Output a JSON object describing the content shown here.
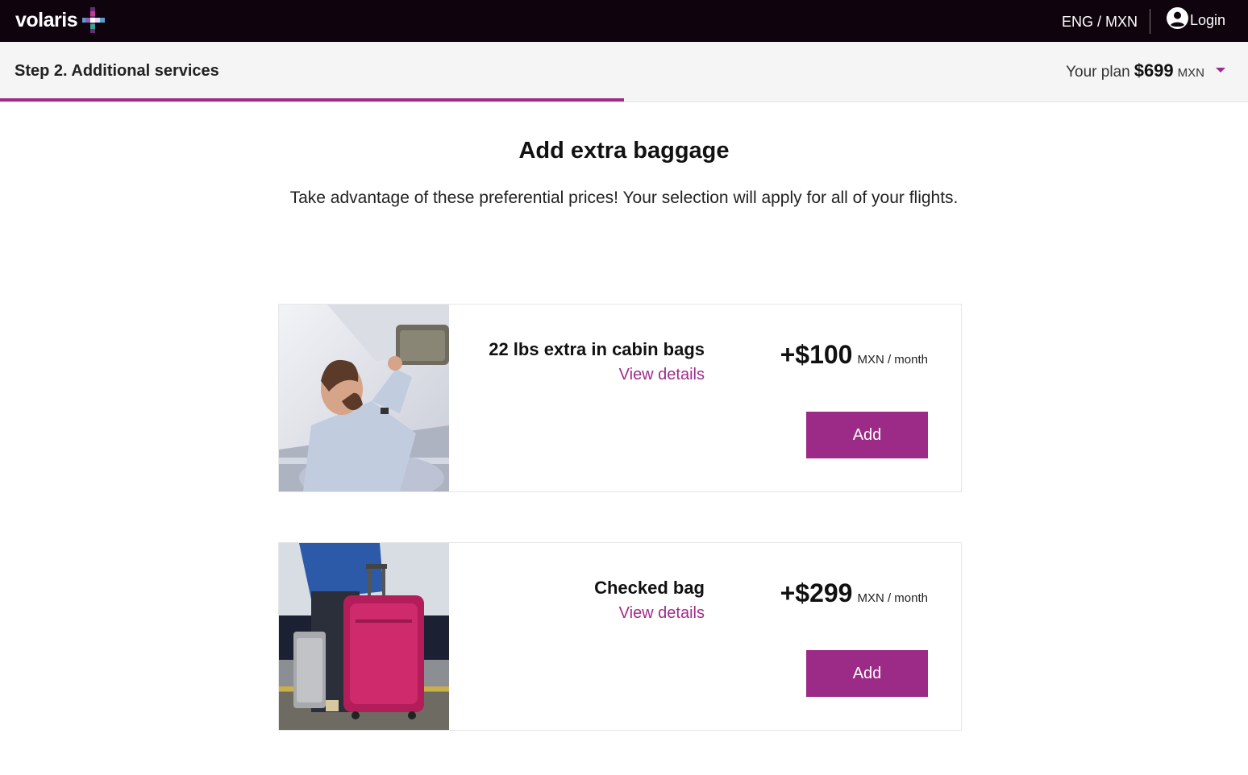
{
  "header": {
    "logo_text": "volaris",
    "logo_icon": "volaris-plus-icon",
    "language": "ENG / MXN",
    "login_icon": "account-circle-icon",
    "login_label": "Login"
  },
  "stepbar": {
    "title": "Step 2. Additional services",
    "plan_label": "Your plan",
    "plan_price": "$699",
    "plan_currency": "MXN",
    "plan_caret_icon": "caret-down-icon",
    "progress_fraction": 0.5
  },
  "main": {
    "heading": "Add extra baggage",
    "subtitle": "Take advantage of these preferential prices! Your selection will apply for all of your flights."
  },
  "offers": [
    {
      "title": "22 lbs extra in cabin bags",
      "details_link": "View details",
      "price": "+$100",
      "unit": "MXN / month",
      "add_label": "Add"
    },
    {
      "title": "Checked bag",
      "details_link": "View details",
      "price": "+$299",
      "unit": "MXN / month",
      "add_label": "Add"
    }
  ],
  "colors": {
    "topbar_bg": "#0f040d",
    "accent": "#a12b8c",
    "button_bg": "#9c2a87",
    "stepbar_bg": "#f5f5f5"
  }
}
